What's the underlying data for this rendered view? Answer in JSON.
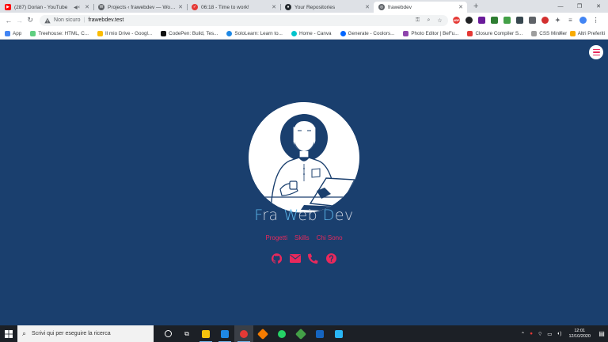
{
  "browser": {
    "tabs": [
      {
        "title": "(287) Dorian - YouTube",
        "favicon": "youtube-icon",
        "color": "#ff0000",
        "muted": true
      },
      {
        "title": "Projects ‹ frawebdev — WordPress",
        "favicon": "wordpress-icon",
        "color": "#5f6368"
      },
      {
        "title": "06:18 - Time to work!",
        "favicon": "timer-icon",
        "color": "#e53935"
      },
      {
        "title": "Your Repositories",
        "favicon": "github-icon",
        "color": "#24292e"
      },
      {
        "title": "frawebdev",
        "favicon": "globe-icon",
        "color": "#5f6368",
        "active": true
      }
    ],
    "address": {
      "security_label": "Non sicuro",
      "url": "frawebdev.test"
    },
    "bookmarks": [
      {
        "label": "App",
        "icon": "apps-grid-icon",
        "color": "#4285f4"
      },
      {
        "label": "Treehouse: HTML, C...",
        "icon": "treehouse-icon",
        "color": "#5fcf80"
      },
      {
        "label": "Il mio Drive - Googl...",
        "icon": "drive-icon",
        "color": "#fbbc04"
      },
      {
        "label": "CodePen: Build, Tes...",
        "icon": "codepen-icon",
        "color": "#111111"
      },
      {
        "label": "SoloLearn: Learn to...",
        "icon": "sololearn-icon",
        "color": "#1e88e5"
      },
      {
        "label": "Home - Canva",
        "icon": "canva-icon",
        "color": "#00c4cc"
      },
      {
        "label": "Generate - Coolors...",
        "icon": "coolors-icon",
        "color": "#0066ff"
      },
      {
        "label": "Photo Editor | BeFu...",
        "icon": "befunky-icon",
        "color": "#8e44ad"
      },
      {
        "label": "Closure Compiler S...",
        "icon": "closure-icon",
        "color": "#e53935"
      },
      {
        "label": "CSS Minifier",
        "icon": "css-minifier-icon",
        "color": "#9e9e9e"
      }
    ],
    "bookmarks_more": "»",
    "other_bookmarks": "Altri Preferiti"
  },
  "page": {
    "brand": {
      "l1": "F",
      "r1": "ra ",
      "l2": "W",
      "r2": "eb ",
      "l3": "D",
      "r3": "ev"
    },
    "nav": [
      "Progetti",
      "Skills",
      "Chi Sono"
    ],
    "socials": [
      "github-icon",
      "mail-icon",
      "phone-icon",
      "question-icon"
    ],
    "colors": {
      "background": "#1a3f6e",
      "accent": "#e8295c",
      "brand_highlight": "#5ab4e8"
    }
  },
  "taskbar": {
    "search_placeholder": "Scrivi qui per eseguire la ricerca",
    "time": "12:01",
    "date": "12/10/2020"
  }
}
